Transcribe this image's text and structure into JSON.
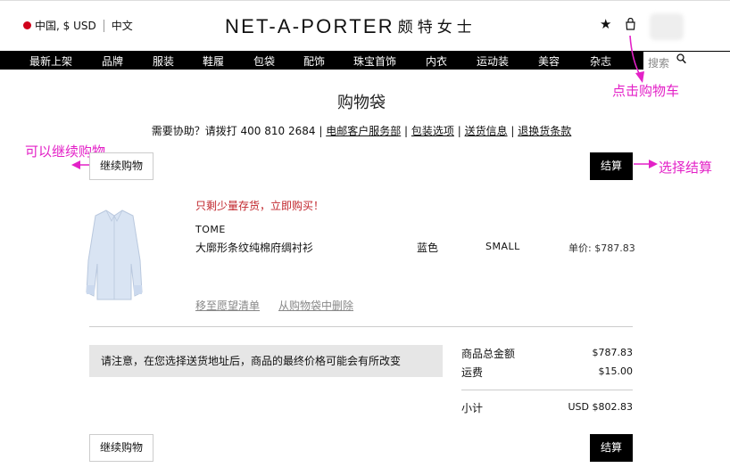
{
  "header": {
    "region": "中国, $ USD",
    "language": "中文",
    "logo_latin": "NET-A-PORTER",
    "logo_cn": "颇特女士"
  },
  "nav": {
    "items": [
      "最新上架",
      "品牌",
      "服装",
      "鞋履",
      "包袋",
      "配饰",
      "珠宝首饰",
      "内衣",
      "运动装",
      "美容",
      "杂志"
    ],
    "search_placeholder": "搜索"
  },
  "page": {
    "title": "购物袋",
    "help_prefix": "需要协助？请拨打 400 810 2684 | ",
    "help_links": [
      "电邮客户服务部",
      "包装选项",
      "送货信息",
      "退换货条款"
    ]
  },
  "buttons": {
    "continue_shopping": "继续购物",
    "checkout": "结算"
  },
  "item": {
    "stock_alert": "只剩少量存货，立即购买！",
    "brand": "TOME",
    "name": "大廓形条纹纯棉府绸衬衫",
    "color": "蓝色",
    "size": "SMALL",
    "unit_price": "单价: $787.83",
    "move_to_wishlist": "移至愿望清单",
    "remove": "从购物袋中删除"
  },
  "summary": {
    "notice": "请注意，在您选择送货地址后，商品的最终价格可能会有所改变",
    "items_total_label": "商品总金额",
    "items_total": "$787.83",
    "shipping_label": "运费",
    "shipping": "$15.00",
    "subtotal_label": "小计",
    "subtotal": "USD $802.83"
  },
  "annotations": {
    "click_cart": "点击购物车",
    "continue": "可以继续购物",
    "checkout": "选择结算"
  },
  "colors": {
    "annotation": "#e321c7",
    "stock_alert": "#c1272d",
    "nav_bg": "#000000"
  }
}
